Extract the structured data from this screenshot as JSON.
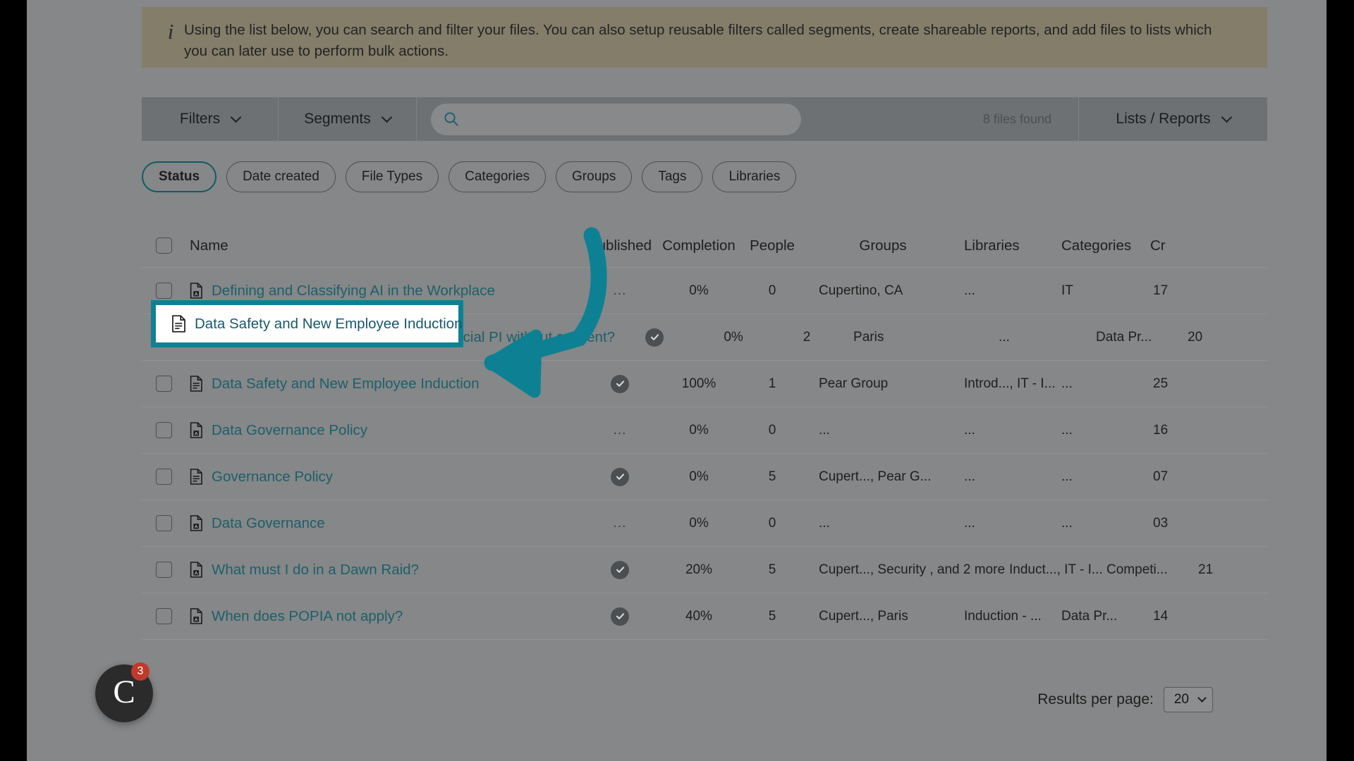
{
  "banner": {
    "icon": "info-icon",
    "text": "Using the list below, you can search and filter your files. You can also setup reusable filters called segments, create shareable reports, and add files to lists which you can later use to perform bulk actions."
  },
  "toolbar": {
    "filters_label": "Filters",
    "segments_label": "Segments",
    "search_value": "",
    "search_placeholder": "",
    "files_found": "8 files found",
    "lists_reports_label": "Lists / Reports"
  },
  "chips": [
    {
      "label": "Status",
      "active": true
    },
    {
      "label": "Date created",
      "active": false
    },
    {
      "label": "File Types",
      "active": false
    },
    {
      "label": "Categories",
      "active": false
    },
    {
      "label": "Groups",
      "active": false
    },
    {
      "label": "Tags",
      "active": false
    },
    {
      "label": "Libraries",
      "active": false
    }
  ],
  "table": {
    "columns": [
      "Name",
      "Published",
      "Completion",
      "People",
      "Groups",
      "Libraries",
      "Categories",
      "Cr"
    ],
    "rows": [
      {
        "name": "Defining and Classifying AI in the Workplace",
        "icon": "pdf-file-icon",
        "published": "...",
        "published_state": "dots",
        "completion": "0%",
        "people": "0",
        "groups": "Cupertino, CA",
        "libraries": "...",
        "categories": "IT",
        "created": "17"
      },
      {
        "name": "Who has a general right to process special PI without consent?",
        "icon": "pdf-file-icon",
        "published": "",
        "published_state": "check",
        "completion": "0%",
        "people": "2",
        "groups": "Paris",
        "libraries": "...",
        "categories": "Data Pr...",
        "created": "20"
      },
      {
        "name": "Data Safety and New Employee Induction",
        "icon": "document-file-icon",
        "published": "",
        "published_state": "check",
        "completion": "100%",
        "people": "1",
        "groups": "Pear Group",
        "libraries": "Introd..., IT - I...",
        "categories": "...",
        "created": "25",
        "highlighted": true
      },
      {
        "name": "Data Governance Policy",
        "icon": "pdf-file-icon",
        "published": "...",
        "published_state": "dots",
        "completion": "0%",
        "people": "0",
        "groups": "...",
        "libraries": "...",
        "categories": "...",
        "created": "16"
      },
      {
        "name": "Governance Policy",
        "icon": "document-file-icon",
        "published": "",
        "published_state": "check",
        "completion": "0%",
        "people": "5",
        "groups": "Cupert..., Pear G...",
        "libraries": "...",
        "categories": "...",
        "created": "07"
      },
      {
        "name": "Data Governance",
        "icon": "pdf-file-icon",
        "published": "...",
        "published_state": "dots",
        "completion": "0%",
        "people": "0",
        "groups": "...",
        "libraries": "...",
        "categories": "...",
        "created": "03"
      },
      {
        "name": "What must I do in a Dawn Raid?",
        "icon": "pdf-file-icon",
        "published": "",
        "published_state": "check",
        "completion": "20%",
        "people": "5",
        "groups": "Cupert..., Security , and 2 more",
        "libraries": "Induct..., IT - I...",
        "categories": "Competi...",
        "created": "21"
      },
      {
        "name": "When does POPIA not apply?",
        "icon": "pdf-file-icon",
        "published": "",
        "published_state": "check",
        "completion": "40%",
        "people": "5",
        "groups": "Cupert..., Paris",
        "libraries": "Induction - ...",
        "categories": "Data Pr...",
        "created": "14"
      }
    ]
  },
  "highlight": {
    "name": "Data Safety and New Employee Induction",
    "icon": "document-file-icon",
    "border_color": "#0d8193"
  },
  "annotation": {
    "type": "curved-arrow",
    "color": "#0d8193"
  },
  "footer": {
    "results_per_page_label": "Results per page:",
    "results_per_page_value": "20"
  },
  "chat_widget": {
    "glyph": "C",
    "badge_count": "3"
  },
  "colors": {
    "accent_teal": "#0d8193",
    "link_teal": "#1d5f6b",
    "banner_bg": "#837d6a",
    "page_bg": "#868788",
    "toolbar_bg": "#6d7174"
  }
}
